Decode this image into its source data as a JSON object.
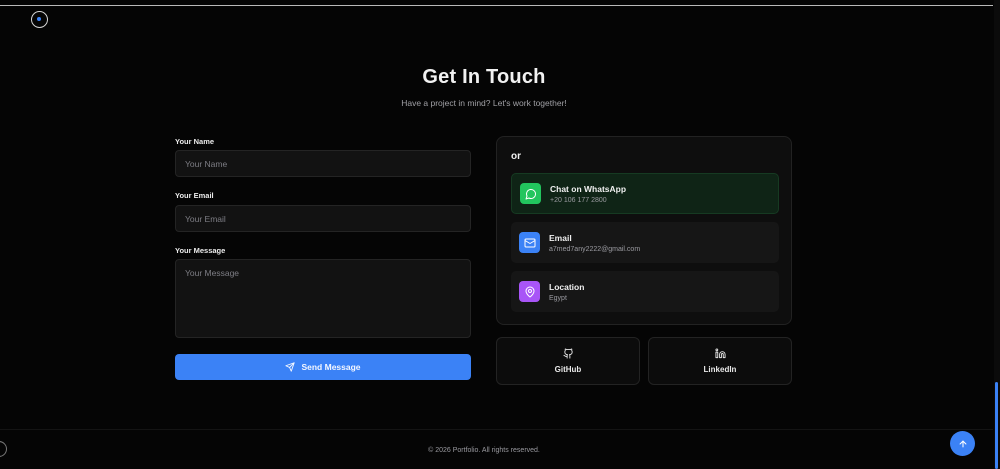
{
  "header": {
    "title": "Get In Touch",
    "subtitle": "Have a project in mind? Let's work together!"
  },
  "form": {
    "name_label": "Your Name",
    "name_placeholder": "Your Name",
    "email_label": "Your Email",
    "email_placeholder": "Your Email",
    "message_label": "Your Message",
    "message_placeholder": "Your Message",
    "send_label": "Send Message"
  },
  "contact": {
    "or_label": "or",
    "cards": [
      {
        "title": "Chat on WhatsApp",
        "value": "+20 106 177 2800",
        "icon": "whatsapp-icon",
        "color": "#22c55e"
      },
      {
        "title": "Email",
        "value": "a7med7any2222@gmail.com",
        "icon": "mail-icon",
        "color": "#3b82f6"
      },
      {
        "title": "Location",
        "value": "Egypt",
        "icon": "map-pin-icon",
        "color": "#a855f7"
      }
    ]
  },
  "social": [
    {
      "label": "GitHub",
      "icon": "github-icon"
    },
    {
      "label": "LinkedIn",
      "icon": "linkedin-icon"
    }
  ],
  "footer": {
    "copyright": "© 2026 Portfolio. All rights reserved."
  },
  "colors": {
    "accent": "#3b82f6",
    "background": "#050505"
  }
}
